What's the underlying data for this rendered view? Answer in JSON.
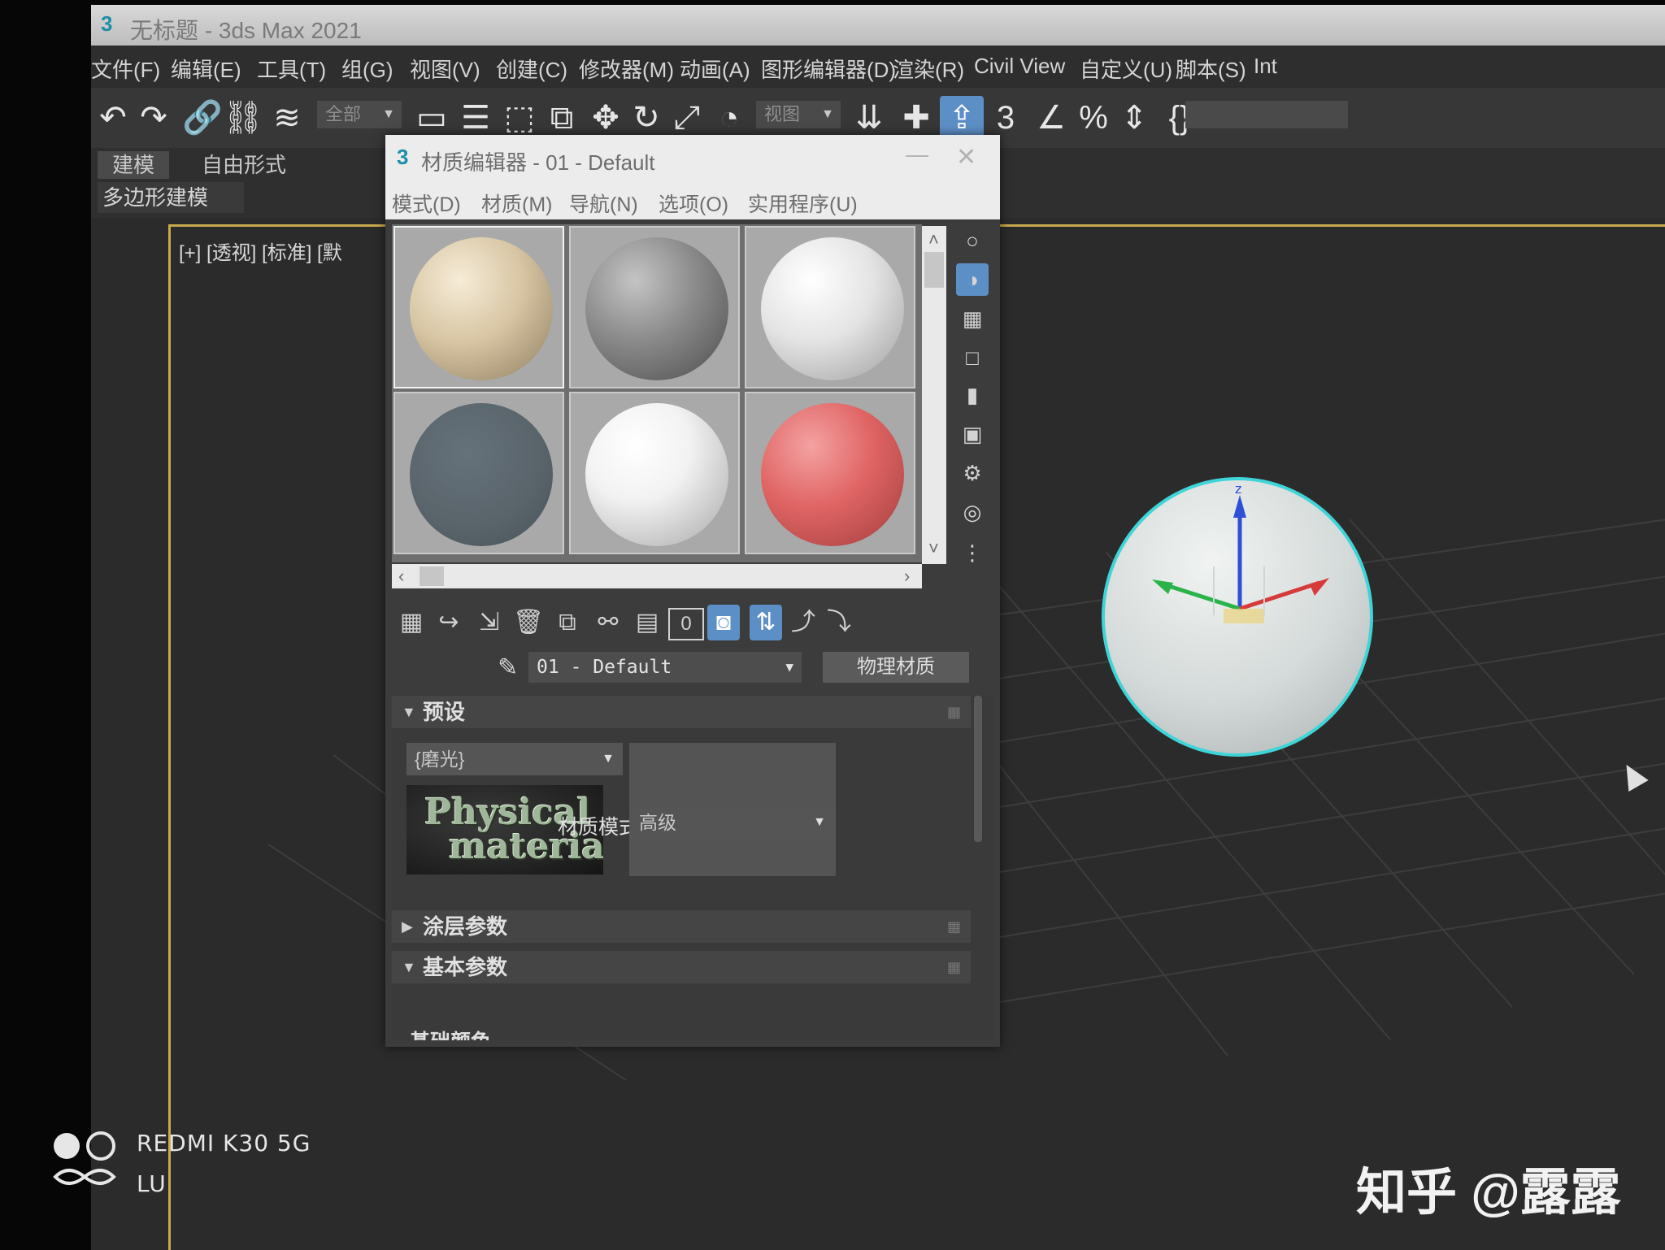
{
  "window": {
    "title": "无标题 - 3ds Max 2021",
    "app_icon": "3ds-max-icon"
  },
  "menubar": [
    "文件(F)",
    "编辑(E)",
    "工具(T)",
    "组(G)",
    "视图(V)",
    "创建(C)",
    "修改器(M)",
    "动画(A)",
    "图形编辑器(D)",
    "渲染(R)",
    "Civil View",
    "自定义(U)",
    "脚本(S)",
    "Int"
  ],
  "toolbar": {
    "selection_filter": "全部",
    "reference_coord": "视图",
    "icons": [
      "undo-icon",
      "redo-icon",
      "link-icon",
      "unlink-icon",
      "bind-space-warp-icon",
      "select-icon",
      "select-by-name-icon",
      "rect-selection-icon",
      "window-crossing-icon",
      "move-icon",
      "rotate-icon",
      "scale-icon",
      "place-icon",
      "mirror-icon",
      "snap-toggle-icon",
      "angle-snap-icon",
      "percent-snap-icon",
      "spinner-snap-icon",
      "named-selection-icon"
    ]
  },
  "ribbon": {
    "tabs": [
      "建模",
      "自由形式"
    ],
    "active_tab": "建模",
    "panel": "多边形建模"
  },
  "viewport": {
    "label": "[+] [透视] [标准] [默"
  },
  "material_editor": {
    "title": "材质编辑器 - 01 - Default",
    "menu": [
      "模式(D)",
      "材质(M)",
      "导航(N)",
      "选项(O)",
      "实用程序(U)"
    ],
    "slots": [
      {
        "name": "beige",
        "color": "#d8c6a4"
      },
      {
        "name": "gray",
        "color": "#8a8a8a"
      },
      {
        "name": "light-gray",
        "color": "#e4e4e4"
      },
      {
        "name": "dark-slate",
        "color": "#58636a"
      },
      {
        "name": "white",
        "color": "#f2f2f2"
      },
      {
        "name": "red",
        "color": "#e06464"
      }
    ],
    "material_name": "01 - Default",
    "material_type": "物理材质",
    "rollouts": {
      "presets": "预设",
      "coating": "涂层参数",
      "basic": "基本参数"
    },
    "preset_value": "{磨光}",
    "preset_logo_line1": "Physical",
    "preset_logo_line2": "material",
    "material_mode_label": "材质模式:",
    "material_mode_value": "高级",
    "base_color_label": "基础颜色",
    "id_channel": "0"
  },
  "watermark": {
    "camera_line1": "REDMI K30 5G",
    "camera_line2": "LU",
    "zhihu": "知乎 @露露"
  }
}
